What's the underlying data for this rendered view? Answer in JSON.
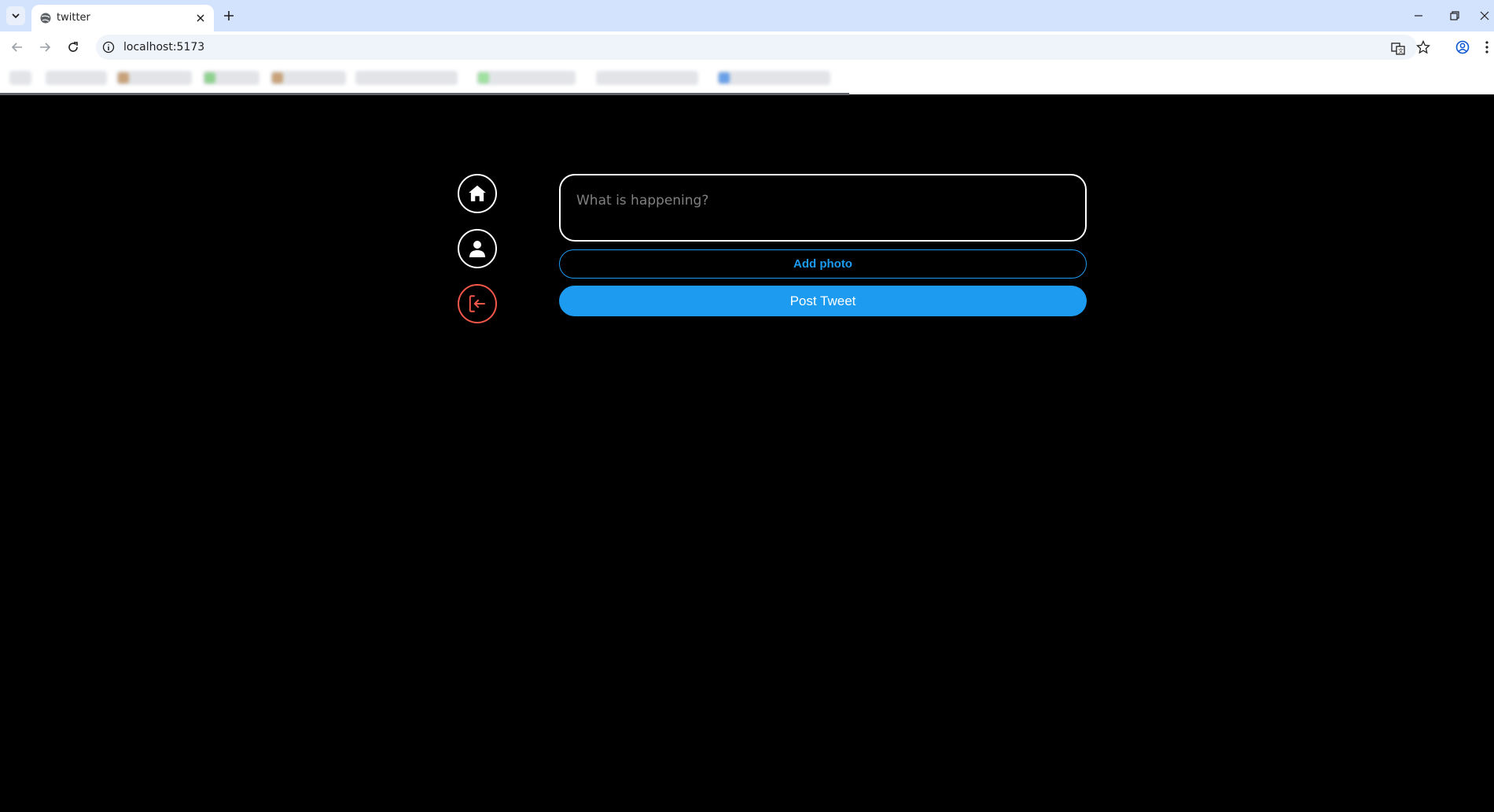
{
  "browser": {
    "tab_title": "twitter",
    "url": "localhost:5173"
  },
  "compose": {
    "placeholder": "What is happening?",
    "add_photo_label": "Add photo",
    "post_label": "Post Tweet"
  },
  "nav": {
    "icons": [
      "home-icon",
      "profile-icon",
      "logout-icon"
    ]
  },
  "colors": {
    "accent": "#1d9bf0",
    "logout": "#f2574a",
    "background": "#000000",
    "border": "#ffffff"
  }
}
